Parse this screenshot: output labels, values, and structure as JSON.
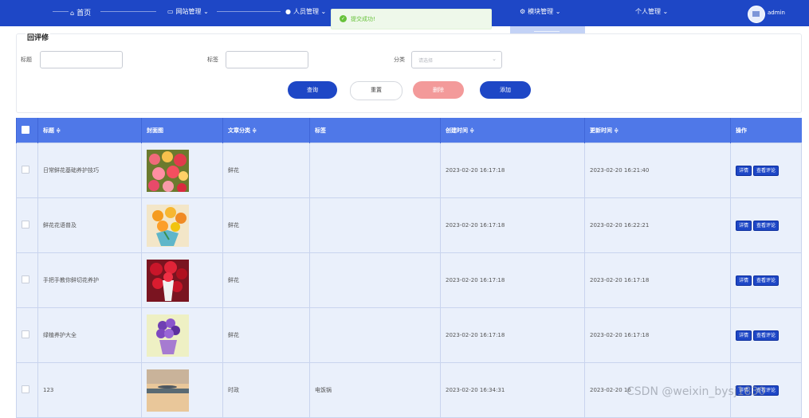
{
  "nav": {
    "home": "首页",
    "site": "网站管理",
    "people": "人员管理",
    "module": "模块管理",
    "personal": "个人管理",
    "username": "admin"
  },
  "toast": {
    "message": "提交成功!"
  },
  "search": {
    "card_title": "回评修",
    "title_label": "标题",
    "tag_label": "标签",
    "category_label": "分类",
    "category_placeholder": "请选择"
  },
  "actions": {
    "query": "查询",
    "reset": "重置",
    "delete": "删除",
    "add": "添加"
  },
  "table": {
    "headers": [
      "标题 ≑",
      "封面图",
      "文章分类 ≑",
      "标签",
      "创建时间 ≑",
      "更新时间 ≑",
      "操作"
    ],
    "op_detail": "详情",
    "op_comments": "查看评论",
    "rows": [
      {
        "title": "日常鲜花基础养护技巧",
        "category": "鲜花",
        "tag": "",
        "created": "2023-02-20 16:17:18",
        "updated": "2023-02-20 16:21:40"
      },
      {
        "title": "鲜花花语普及",
        "category": "鲜花",
        "tag": "",
        "created": "2023-02-20 16:17:18",
        "updated": "2023-02-20 16:22:21"
      },
      {
        "title": "手把手教你鲜切花养护",
        "category": "鲜花",
        "tag": "",
        "created": "2023-02-20 16:17:18",
        "updated": "2023-02-20 16:17:18"
      },
      {
        "title": "绿植养护大全",
        "category": "鲜花",
        "tag": "",
        "created": "2023-02-20 16:17:18",
        "updated": "2023-02-20 16:17:18"
      },
      {
        "title": "123",
        "category": "时政",
        "tag": "电饭锅",
        "created": "2023-02-20 16:34:31",
        "updated": "2023-02-20 16"
      }
    ]
  },
  "watermark": "CSDN @weixin_bysj1830",
  "colors": {
    "primary": "#1e47c6",
    "header": "#4f78e8",
    "danger": "#f39a9a",
    "success": "#67c23a",
    "row_bg": "#eaf0fb"
  }
}
